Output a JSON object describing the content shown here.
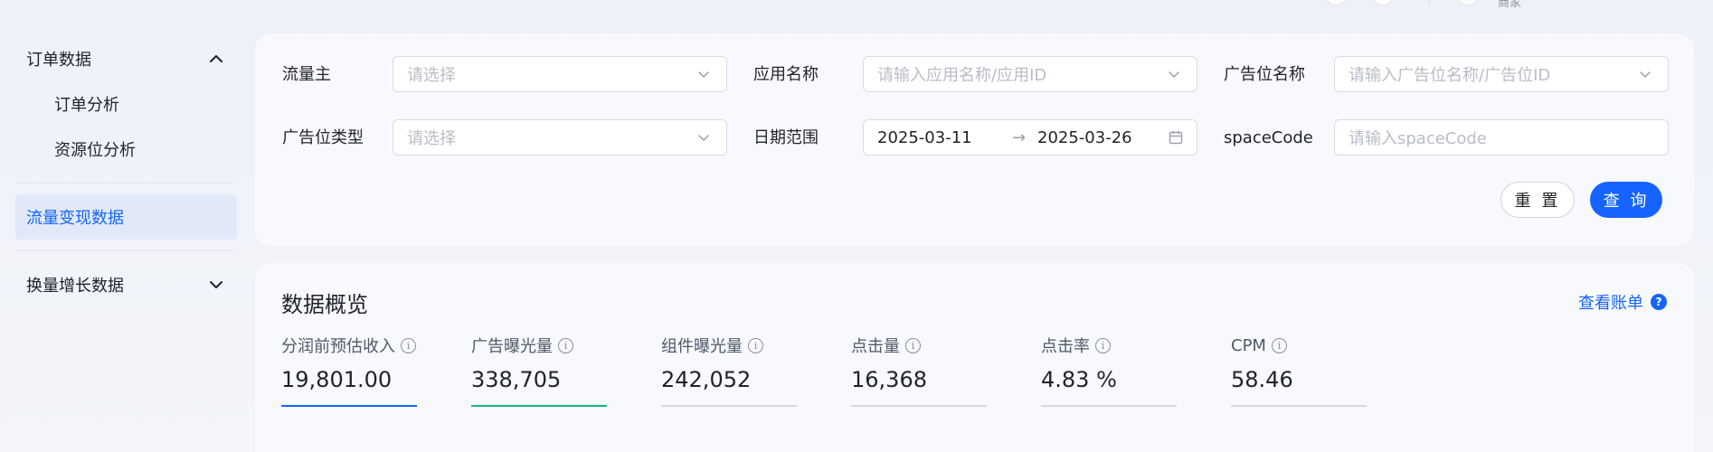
{
  "header": {
    "user_text": "商家"
  },
  "sidebar": {
    "groups": [
      {
        "label": "订单数据",
        "expanded": true,
        "items": [
          {
            "label": "订单分析"
          },
          {
            "label": "资源位分析"
          }
        ]
      },
      {
        "label": "流量变现数据",
        "active": true
      },
      {
        "label": "换量增长数据",
        "expanded": false
      }
    ]
  },
  "filters": {
    "traffic_owner": {
      "label": "流量主",
      "placeholder": "请选择"
    },
    "app_name": {
      "label": "应用名称",
      "placeholder": "请输入应用名称/应用ID"
    },
    "ad_slot_name": {
      "label": "广告位名称",
      "placeholder": "请输入广告位名称/广告位ID"
    },
    "ad_slot_type": {
      "label": "广告位类型",
      "placeholder": "请选择"
    },
    "date_range": {
      "label": "日期范围",
      "start": "2025-03-11",
      "separator": "→",
      "end": "2025-03-26"
    },
    "space_code": {
      "label": "spaceCode",
      "placeholder": "请输入spaceCode"
    },
    "reset_label": "重 置",
    "query_label": "查 询"
  },
  "overview": {
    "title": "数据概览",
    "view_bill_label": "查看账单",
    "help_glyph": "?",
    "info_glyph": "i",
    "metrics": [
      {
        "label": "分润前预估收入",
        "value": "19,801.00",
        "bar_color": "#1664ff"
      },
      {
        "label": "广告曝光量",
        "value": "338,705",
        "bar_color": "#14b87a"
      },
      {
        "label": "组件曝光量",
        "value": "242,052",
        "bar_color": "#d6d9df"
      },
      {
        "label": "点击量",
        "value": "16,368",
        "bar_color": "#d6d9df"
      },
      {
        "label": "点击率",
        "value": "4.83 %",
        "bar_color": "#d6d9df"
      },
      {
        "label": "CPM",
        "value": "58.46",
        "bar_color": "#d6d9df"
      }
    ]
  },
  "colors": {
    "accent": "#1664ff",
    "active_bg": "#e1e9f9",
    "green": "#14b87a"
  }
}
